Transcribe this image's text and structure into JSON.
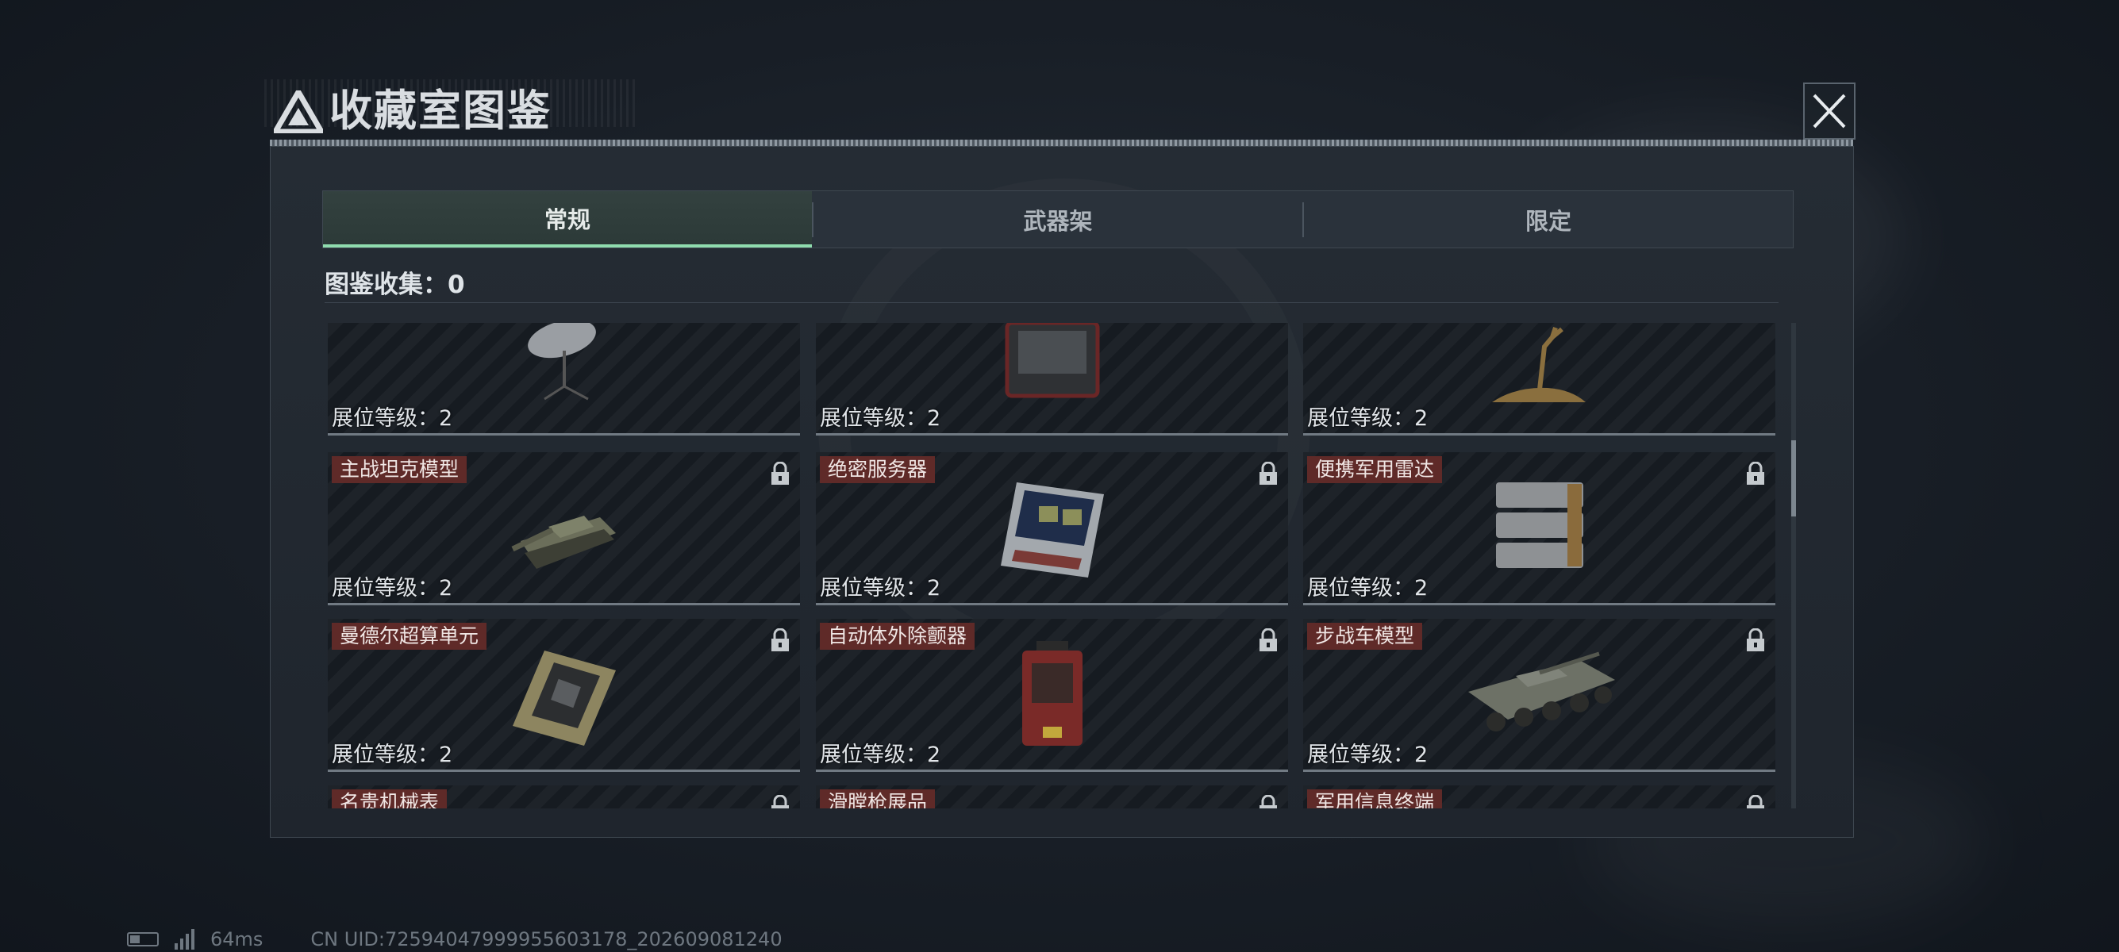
{
  "window": {
    "title": "收藏室图鉴"
  },
  "tabs": [
    {
      "label": "常规",
      "active": true
    },
    {
      "label": "武器架",
      "active": false
    },
    {
      "label": "限定",
      "active": false
    }
  ],
  "collection": {
    "text": "图鉴收集：0"
  },
  "cards": [
    {
      "name": "",
      "level": "展位等级：2",
      "locked": false,
      "icon": "satellite-dish-icon"
    },
    {
      "name": "",
      "level": "展位等级：2",
      "locked": false,
      "icon": "device-case-icon"
    },
    {
      "name": "",
      "level": "展位等级：2",
      "locked": false,
      "icon": "deer-statue-icon"
    },
    {
      "name": "主战坦克模型",
      "level": "展位等级：2",
      "locked": true,
      "icon": "tank-icon"
    },
    {
      "name": "绝密服务器",
      "level": "展位等级：2",
      "locked": true,
      "icon": "server-icon"
    },
    {
      "name": "便携军用雷达",
      "level": "展位等级：2",
      "locked": true,
      "icon": "radar-icon"
    },
    {
      "name": "曼德尔超算单元",
      "level": "展位等级：2",
      "locked": true,
      "icon": "compute-unit-icon"
    },
    {
      "name": "自动体外除颤器",
      "level": "展位等级：2",
      "locked": true,
      "icon": "defibrillator-icon"
    },
    {
      "name": "步战车模型",
      "level": "展位等级：2",
      "locked": true,
      "icon": "ifv-icon"
    },
    {
      "name": "名贵机械表",
      "level": "",
      "locked": true,
      "icon": "watch-icon"
    },
    {
      "name": "滑膛枪展品",
      "level": "",
      "locked": true,
      "icon": "musket-icon"
    },
    {
      "name": "军用信息终端",
      "level": "",
      "locked": true,
      "icon": "terminal-icon"
    }
  ],
  "status_bar": {
    "ping": "64ms",
    "uid": "CN UID:7259404799995560317​8_202609081240"
  },
  "colors": {
    "active_tab_underline": "#8fdcae",
    "name_badge": "#5f2a28"
  }
}
